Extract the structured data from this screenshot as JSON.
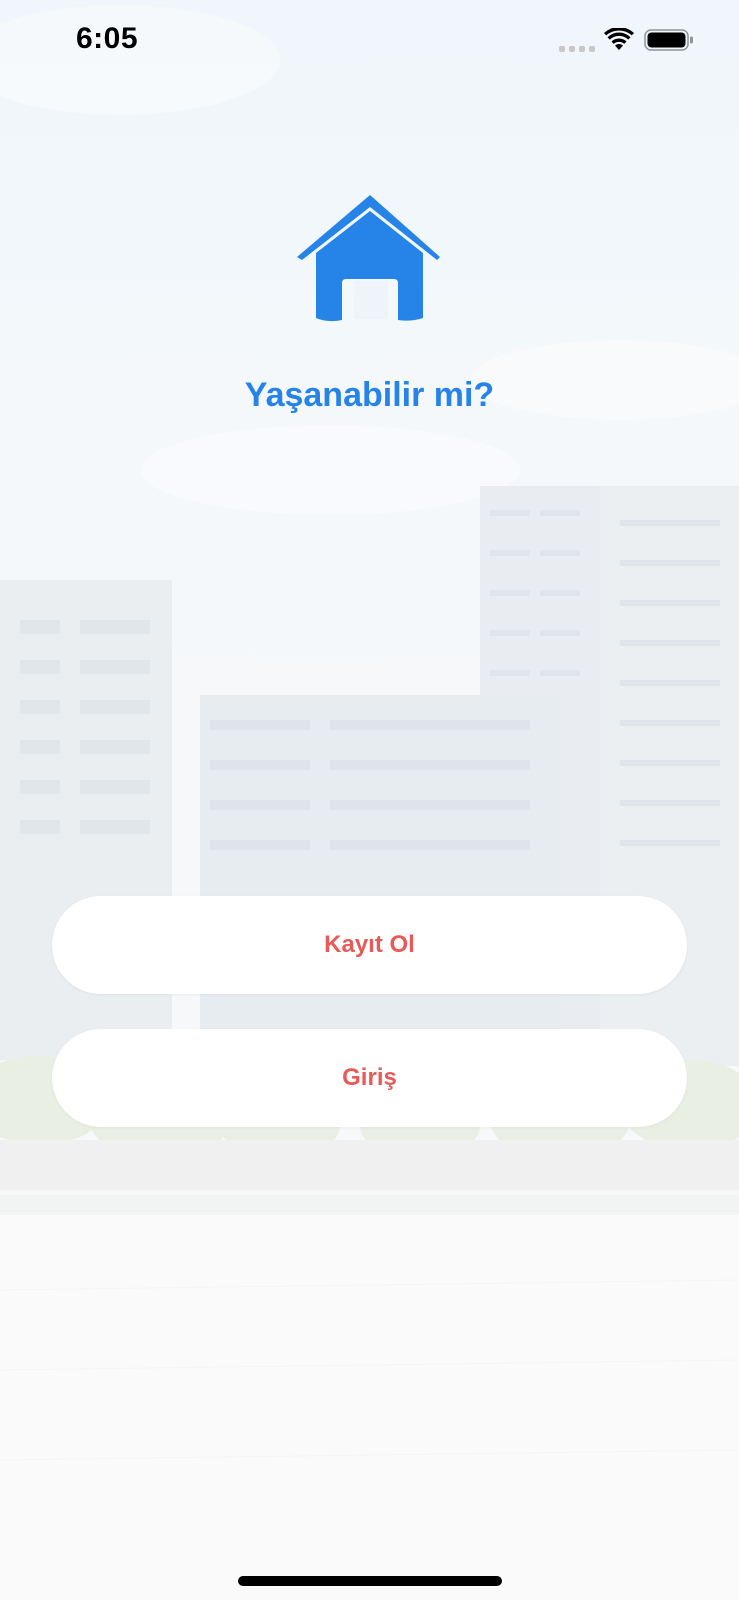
{
  "status_bar": {
    "time": "6:05",
    "signal_icon": "cellular-signal-icon",
    "wifi_icon": "wifi-icon",
    "battery_icon": "battery-icon"
  },
  "logo": {
    "icon": "house-icon",
    "color": "#2684e8"
  },
  "app_title": "Yaşanabilir mi?",
  "buttons": {
    "register_label": "Kayıt Ol",
    "login_label": "Giriş",
    "text_color": "#e85a58"
  },
  "background": {
    "image": "city-buildings-background"
  }
}
